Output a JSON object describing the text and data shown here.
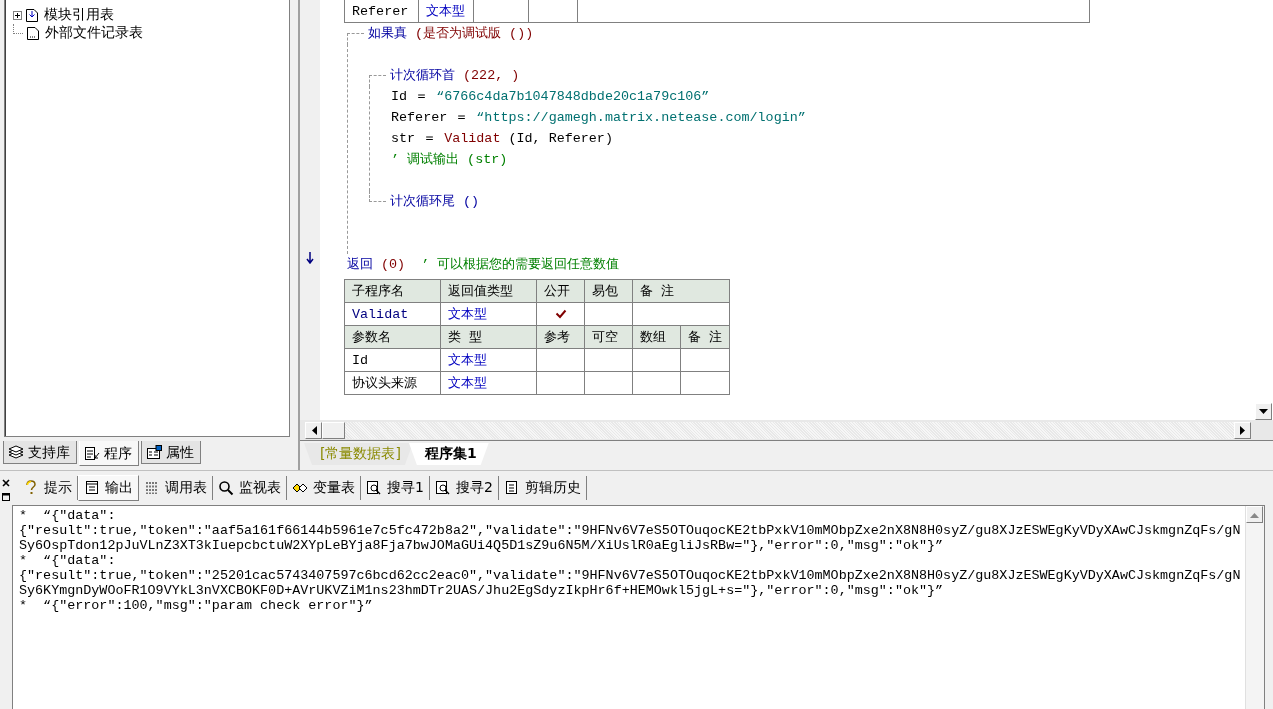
{
  "tree": [
    {
      "label": "模块引用表",
      "kind": "group"
    },
    {
      "label": "外部文件记录表",
      "kind": "file"
    }
  ],
  "left_tabs": [
    {
      "label": "支持库",
      "selected": false
    },
    {
      "label": "程序",
      "selected": true
    },
    {
      "label": "属性",
      "selected": false
    }
  ],
  "var_table": {
    "rows": [
      {
        "name": "Referer",
        "type": "文本型"
      }
    ]
  },
  "statements": [
    {
      "kind": "block",
      "segments": [
        {
          "text": "如果真",
          "kind": "kw"
        },
        {
          "text": " (是否为调试版 ())",
          "kind": "fn"
        }
      ],
      "children": [
        {
          "kind": "blank"
        },
        {
          "kind": "loop",
          "segments": [
            {
              "text": "计次循环首",
              "kind": "kw"
            },
            {
              "text": " (222, )",
              "kind": "fn"
            }
          ],
          "children": [
            {
              "kind": "line",
              "segments": [
                {
                  "text": "Id ＝ ",
                  "kind": "txt"
                },
                {
                  "text": "“6766c4da7b1047848dbde20c1a79c106”",
                  "kind": "str"
                }
              ]
            },
            {
              "kind": "line",
              "segments": [
                {
                  "text": "Referer ＝ ",
                  "kind": "txt"
                },
                {
                  "text": "“https://gamegh.matrix.netease.com/login”",
                  "kind": "str"
                }
              ]
            },
            {
              "kind": "line",
              "segments": [
                {
                  "text": "str ＝ ",
                  "kind": "txt"
                },
                {
                  "text": "Validat",
                  "kind": "fn"
                },
                {
                  "text": " (Id, Referer)",
                  "kind": "txt"
                }
              ]
            },
            {
              "kind": "line",
              "segments": [
                {
                  "text": "’ 调试输出 (str)",
                  "kind": "cmt"
                }
              ]
            },
            {
              "kind": "blank"
            }
          ],
          "end": [
            {
              "text": "计次循环尾",
              "kind": "kw"
            },
            {
              "text": " ()",
              "kind": "kw"
            }
          ]
        },
        {
          "kind": "blank"
        },
        {
          "kind": "blank"
        }
      ]
    },
    {
      "kind": "line",
      "segments": [
        {
          "text": "返回",
          "kind": "kw"
        },
        {
          "text": " (0) ",
          "kind": "fn"
        },
        {
          "text": " ’ 可以根据您的需要返回任意数值",
          "kind": "cmt"
        }
      ]
    }
  ],
  "sub_table": {
    "header": [
      "子程序名",
      "返回值类型",
      "公开",
      "易包",
      "备 注"
    ],
    "row": {
      "name": "Validat",
      "type": "文本型",
      "public": true,
      "easy_package": false
    },
    "param_header": [
      "参数名",
      "类 型",
      "参考",
      "可空",
      "数组",
      "备 注"
    ],
    "params": [
      {
        "name": "Id",
        "type": "文本型",
        "reference": false,
        "nullable": false,
        "array": false
      },
      {
        "name": "协议头来源",
        "type": "文本型",
        "reference": false,
        "nullable": false,
        "array": false
      }
    ]
  },
  "editor_tabs": [
    {
      "label": "[常量数据表]",
      "selected": false
    },
    {
      "label": "程序集1",
      "selected": true
    }
  ],
  "output_tabs": [
    {
      "label": "提示",
      "selected": false
    },
    {
      "label": "输出",
      "selected": true
    },
    {
      "label": "调用表",
      "selected": false
    },
    {
      "label": "监视表",
      "selected": false
    },
    {
      "label": "变量表",
      "selected": false
    },
    {
      "label": "搜寻1",
      "selected": false
    },
    {
      "label": "搜寻2",
      "selected": false
    },
    {
      "label": "剪辑历史",
      "selected": false
    }
  ],
  "output_lines": [
    "*  “{\"data\":",
    "{\"result\":true,\"token\":\"aaf5a161f66144b5961e7c5fc472b8a2\",\"validate\":\"9HFNv6V7eS5OTOuqocKE2tbPxkV10mMObpZxe2nX8N8H0syZ/gu8XJzESWEgKyVDyXAwCJskmgnZqFs/gN",
    "Sy6OspTdon12pJuVLnZ3XT3kIuepcbctuW2XYpLeBYja8Fja7bwJOMaGUi4Q5D1sZ9u6N5M/XiUslR0aEgliJsRBw=\"},\"error\":0,\"msg\":\"ok\"}”",
    "*  “{\"data\":",
    "{\"result\":true,\"token\":\"25201cac5743407597c6bcd62cc2eac0\",\"validate\":\"9HFNv6V7eS5OTOuqocKE2tbPxkV10mMObpZxe2nX8N8H0syZ/gu8XJzESWEgKyVDyXAwCJskmgnZqFs/gN",
    "Sy6KYmgnDyWOoFR1O9VYkL3nVXCBOKF0D+AVrUKVZiM1ns23hmDTr2UAS/Jhu2EgSdyzIkpHr6f+HEMOwkl5jgL+s=\"},\"error\":0,\"msg\":\"ok\"}”",
    "*  “{\"error\":100,\"msg\":\"param check error\"}”"
  ]
}
